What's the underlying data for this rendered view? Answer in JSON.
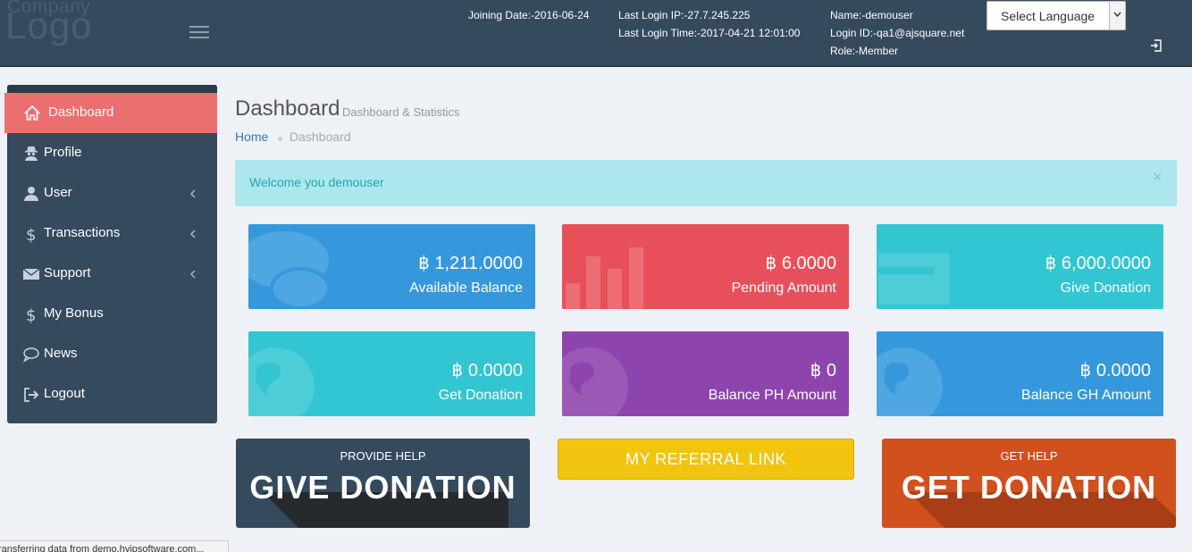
{
  "header": {
    "logo_line1": "Company",
    "logo_line2": "Logo",
    "joining_date": "Joining Date:-2016-06-24",
    "last_login_ip": "Last Login IP:-27.7.245.225",
    "last_login_time": "Last Login Time:-2017-04-21 12:01:00",
    "name": "Name:-demouser",
    "login_id": "Login ID:-qa1@ajsquare.net",
    "role": "Role:-Member",
    "language_select": "Select Language"
  },
  "sidebar": {
    "items": [
      {
        "label": "Dashboard",
        "icon": "home-icon"
      },
      {
        "label": "Profile",
        "icon": "user-secret-icon"
      },
      {
        "label": "User",
        "icon": "user-icon"
      },
      {
        "label": "Transactions",
        "icon": "dollar-icon"
      },
      {
        "label": "Support",
        "icon": "envelope-icon"
      },
      {
        "label": "My Bonus",
        "icon": "dollar-icon"
      },
      {
        "label": "News",
        "icon": "comment-icon"
      },
      {
        "label": "Logout",
        "icon": "sign-out-icon"
      }
    ]
  },
  "main": {
    "title": "Dashboard",
    "subtitle": "Dashboard & Statistics",
    "breadcrumb_home": "Home",
    "breadcrumb_current": "Dashboard",
    "alert_text": "Welcome you demouser",
    "alert_close": "×",
    "tiles": [
      {
        "value": "฿ 1,211.0000",
        "label": "Available Balance",
        "color": "#3598dc"
      },
      {
        "value": "฿ 6.0000",
        "label": "Pending Amount",
        "color": "#e7505a"
      },
      {
        "value": "฿ 6,000.0000",
        "label": "Give Donation",
        "color": "#32c5d2"
      },
      {
        "value": "฿ 0.0000",
        "label": "Get Donation",
        "color": "#32c5d2"
      },
      {
        "value": "฿ 0",
        "label": "Balance PH Amount",
        "color": "#8e44ad"
      },
      {
        "value": "฿ 0.0000",
        "label": "Balance GH Amount",
        "color": "#3598dc"
      }
    ],
    "provide_help": {
      "small": "PROVIDE HELP",
      "large": "GIVE DONATION",
      "color": "#364a5e"
    },
    "referral": {
      "label": "MY REFERRAL LINK",
      "color": "#f1c40f"
    },
    "get_help": {
      "small": "GET HELP",
      "large": "GET DONATION",
      "color": "#d0501e"
    }
  },
  "status_bar": "ransferring data from demo.hyipsoftware.com..."
}
